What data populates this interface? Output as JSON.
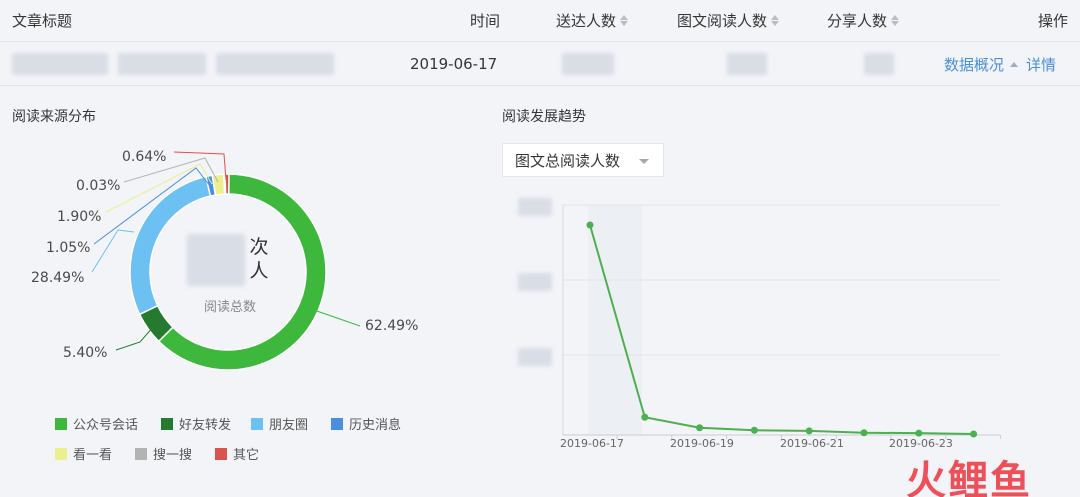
{
  "table": {
    "headers": {
      "title": "文章标题",
      "time": "时间",
      "delivered": "送达人数",
      "reads": "图文阅读人数",
      "shares": "分享人数",
      "actions": "操作"
    },
    "row": {
      "date": "2019-06-17",
      "overview_link": "数据概况",
      "detail_link": "详情"
    }
  },
  "left_section": {
    "title": "阅读来源分布",
    "center_unit": "次\n人",
    "center_label": "阅读总数"
  },
  "right_section": {
    "title": "阅读发展趋势",
    "dropdown_value": "图文总阅读人数"
  },
  "colors": {
    "accent_link": "#4a8fd6",
    "line_green": "#4cb04f"
  },
  "chart_data": [
    {
      "type": "pie",
      "title": "阅读来源分布",
      "categories": [
        "公众号会话",
        "好友转发",
        "朋友圈",
        "历史消息",
        "看一看",
        "搜一搜",
        "其它"
      ],
      "values": [
        62.49,
        5.4,
        28.49,
        1.05,
        1.9,
        0.03,
        0.64
      ],
      "value_labels": [
        "62.49%",
        "5.40%",
        "28.49%",
        "1.05%",
        "1.90%",
        "0.03%",
        "0.64%"
      ],
      "colors": [
        "#3db83d",
        "#267a2f",
        "#6cc0f2",
        "#4a8ee0",
        "#ebef8e",
        "#b3b3b3",
        "#d9534f"
      ],
      "legend": "bottom"
    },
    {
      "type": "line",
      "title": "阅读发展趋势",
      "x": [
        "2019-06-17",
        "2019-06-18",
        "2019-06-19",
        "2019-06-20",
        "2019-06-21",
        "2019-06-22",
        "2019-06-23",
        "2019-06-24"
      ],
      "x_tick_labels": [
        "2019-06-17",
        "2019-06-19",
        "2019-06-21",
        "2019-06-23"
      ],
      "values": [
        100,
        8,
        3,
        1.8,
        1.5,
        0.6,
        0.4,
        0
      ],
      "grid": true
    }
  ]
}
